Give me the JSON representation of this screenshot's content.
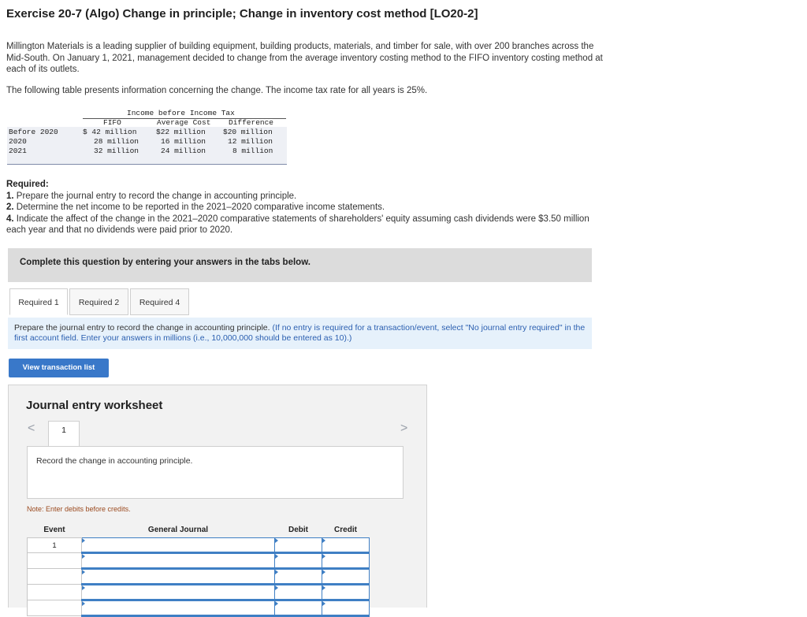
{
  "title": "Exercise 20-7 (Algo) Change in principle; Change in inventory cost method [LO20-2]",
  "intro": "Millington Materials is a leading supplier of building equipment, building products, materials, and timber for sale, with over 200 branches across the Mid-South. On January 1, 2021, management decided to change from the average inventory costing method to the FIFO inventory costing method at each of its outlets.",
  "tax_line": "The following table presents information concerning the change. The income tax rate for all years is 25%.",
  "table": {
    "group_header": "Income before Income Tax",
    "columns": [
      "FIFO",
      "Average Cost",
      "Difference"
    ],
    "rows": [
      {
        "label": "Before 2020",
        "fifo": "$ 42 million",
        "avg": "$22 million",
        "diff": "$20 million"
      },
      {
        "label": "2020",
        "fifo": "28 million",
        "avg": "16 million",
        "diff": "12 million"
      },
      {
        "label": "2021",
        "fifo": "32 million",
        "avg": "24 million",
        "diff": "8 million"
      }
    ]
  },
  "required": {
    "heading": "Required:",
    "items": [
      {
        "num": "1.",
        "text": "Prepare the journal entry to record the change in accounting principle."
      },
      {
        "num": "2.",
        "text": "Determine the net income to be reported in the 2021–2020 comparative income statements."
      },
      {
        "num": "4.",
        "text": "Indicate the affect of the change in the 2021–2020 comparative statements of shareholders' equity assuming cash dividends were $3.50 million each year and that no dividends were paid prior to 2020."
      }
    ]
  },
  "banner": "Complete this question by entering your answers in the tabs below.",
  "tabs": [
    "Required 1",
    "Required 2",
    "Required 4"
  ],
  "instruction": {
    "main": "Prepare the journal entry to record the change in accounting principle.",
    "hint": "(If no entry is required for a transaction/event, select \"No journal entry required\" in the first account field. Enter your answers in millions (i.e., 10,000,000 should be entered as 10).)"
  },
  "view_button": "View transaction list",
  "worksheet": {
    "title": "Journal entry worksheet",
    "nav_prev": "<",
    "nav_next": ">",
    "page": "1",
    "record_text": "Record the change in accounting principle.",
    "note": "Note: Enter debits before credits.",
    "headers": {
      "event": "Event",
      "journal": "General Journal",
      "debit": "Debit",
      "credit": "Credit"
    },
    "first_event": "1"
  },
  "colors": {
    "button": "#3978c9",
    "instruction_bg": "#e6f1fb",
    "banner_bg": "#dcdcdc",
    "input_border": "#3f7fc4"
  }
}
